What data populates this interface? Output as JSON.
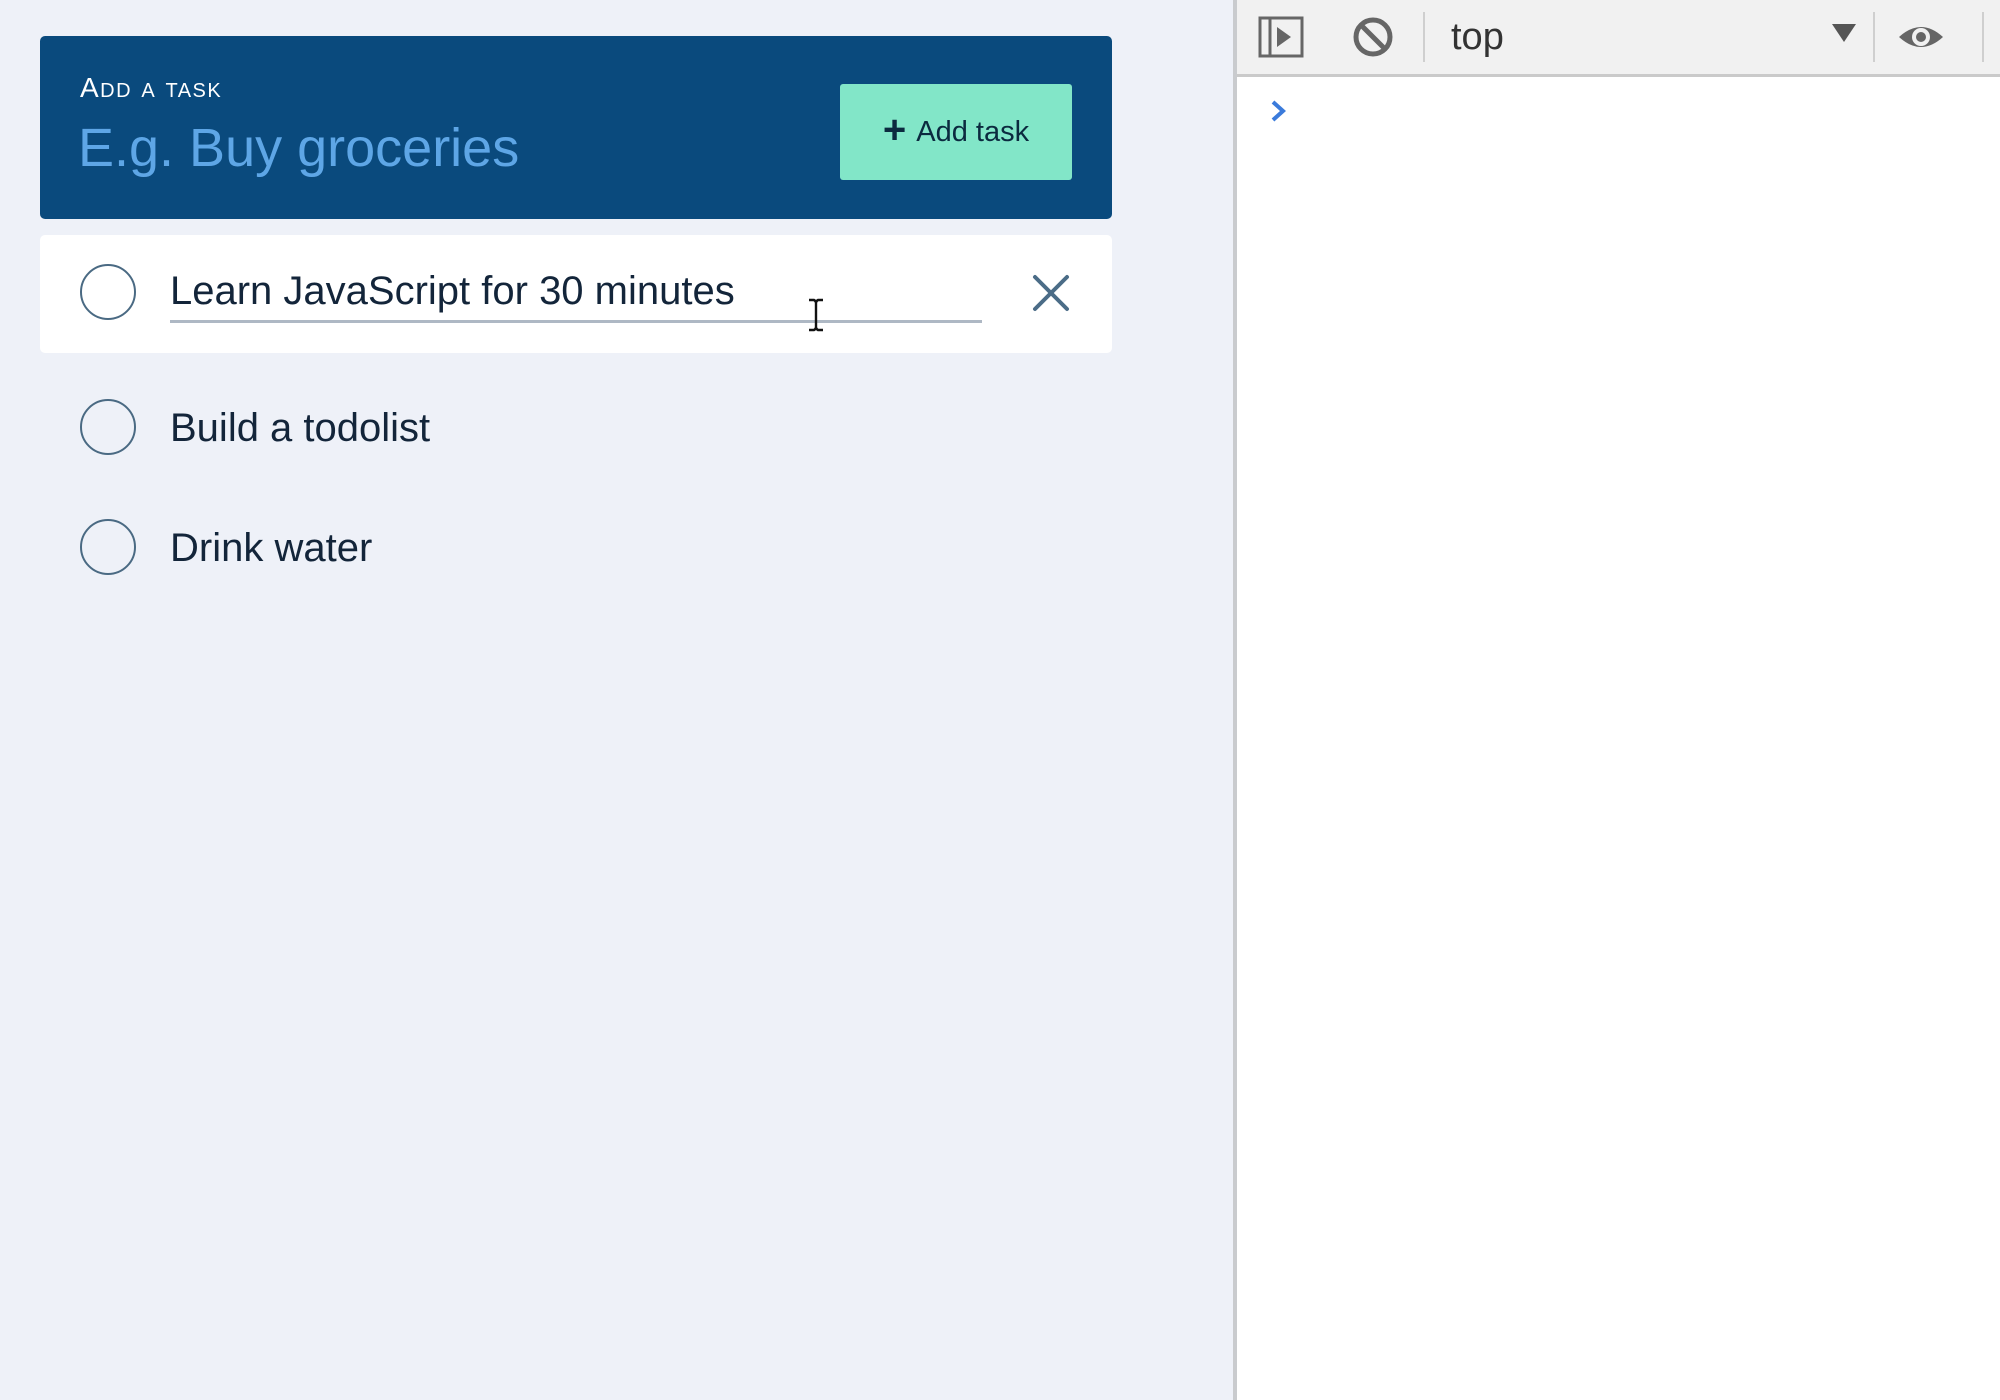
{
  "app": {
    "add_task": {
      "label": "Add a task",
      "placeholder": "E.g. Buy groceries",
      "button_label": "Add task",
      "button_icon": "plus-icon",
      "colors": {
        "panel": "#0a4a7d",
        "placeholder": "#5ea6e6",
        "button": "#82e6c8"
      }
    },
    "tasks": [
      {
        "text": "Learn JavaScript for 30 minutes",
        "state": "editing",
        "completed": false
      },
      {
        "text": "Build a todolist",
        "state": "normal",
        "completed": false
      },
      {
        "text": "Drink water",
        "state": "normal",
        "completed": false
      }
    ],
    "icons": {
      "checkbox": "circle-checkbox-icon",
      "delete": "close-icon",
      "cursor": "text-cursor-icon"
    }
  },
  "devtools": {
    "toolbar": {
      "sidebar_toggle_icon": "sidebar-play-icon",
      "clear_icon": "block-icon",
      "context": "top",
      "context_icon": "chevron-down-icon",
      "live_expression_icon": "eye-icon"
    },
    "console": {
      "prompt_icon": "chevron-right-icon",
      "prompt_color": "#3b7bdb"
    }
  }
}
